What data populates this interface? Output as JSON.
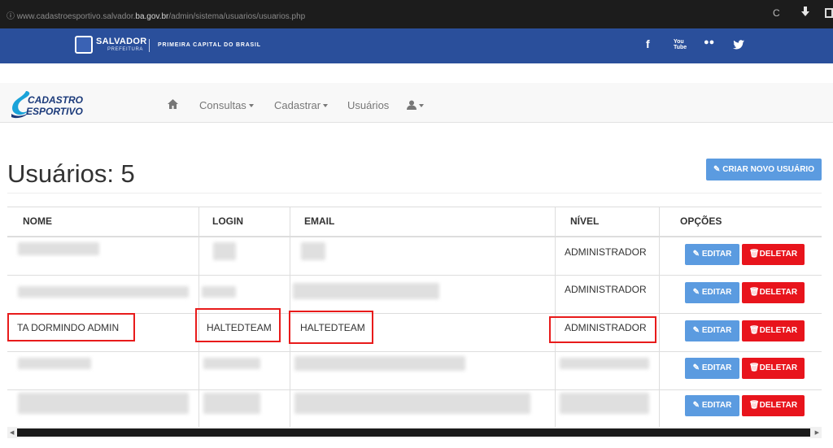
{
  "browser": {
    "url_prefix": "www.cadastroesportivo.salvador.",
    "url_domain": "ba.gov.br",
    "url_path": "/admin/sistema/usuarios/usuarios.php",
    "reload_icon": "reload-icon",
    "download_icon": "download-icon"
  },
  "topbar": {
    "brand": "SALVADOR",
    "brand_sub": "PREFEITURA",
    "tagline": "PRIMEIRA CAPITAL DO BRASIL",
    "social": [
      "f",
      "You Tube",
      "••",
      "twitter"
    ],
    "bg_color": "#2a4f9b"
  },
  "logo": {
    "line1": "CADASTRO",
    "line2": "ESPORTIVO"
  },
  "nav": {
    "home_icon": "home-icon",
    "consultas": "Consultas",
    "cadastrar": "Cadastrar",
    "usuarios": "Usuários",
    "user_icon": "user-icon"
  },
  "page": {
    "title": "Usuários: 5",
    "create_button": "CRIAR NOVO USUÁRIO"
  },
  "table": {
    "columns": [
      "NOME",
      "LOGIN",
      "EMAIL",
      "NÍVEL",
      "OPÇÕES"
    ],
    "rows": [
      {
        "nome": "",
        "login": "",
        "email": "",
        "nivel": "ADMINISTRADOR",
        "blurred": true
      },
      {
        "nome": "",
        "login": "",
        "email": "",
        "nivel": "ADMINISTRADOR",
        "blurred": true
      },
      {
        "nome": "TA DORMINDO ADMIN",
        "login": "HALTEDTEAM",
        "email": "HALTEDTEAM",
        "nivel": "ADMINISTRADOR",
        "blurred": false,
        "highlighted": true
      },
      {
        "nome": "",
        "login": "",
        "email": "",
        "nivel": "",
        "blurred": true
      },
      {
        "nome": "",
        "login": "",
        "email": "",
        "nivel": "",
        "blurred": true
      }
    ],
    "edit_label": "EDITAR",
    "delete_label": "DELETAR"
  },
  "colors": {
    "primary": "#5b9be0",
    "danger": "#e8141c",
    "highlight": "#e81b1b"
  }
}
